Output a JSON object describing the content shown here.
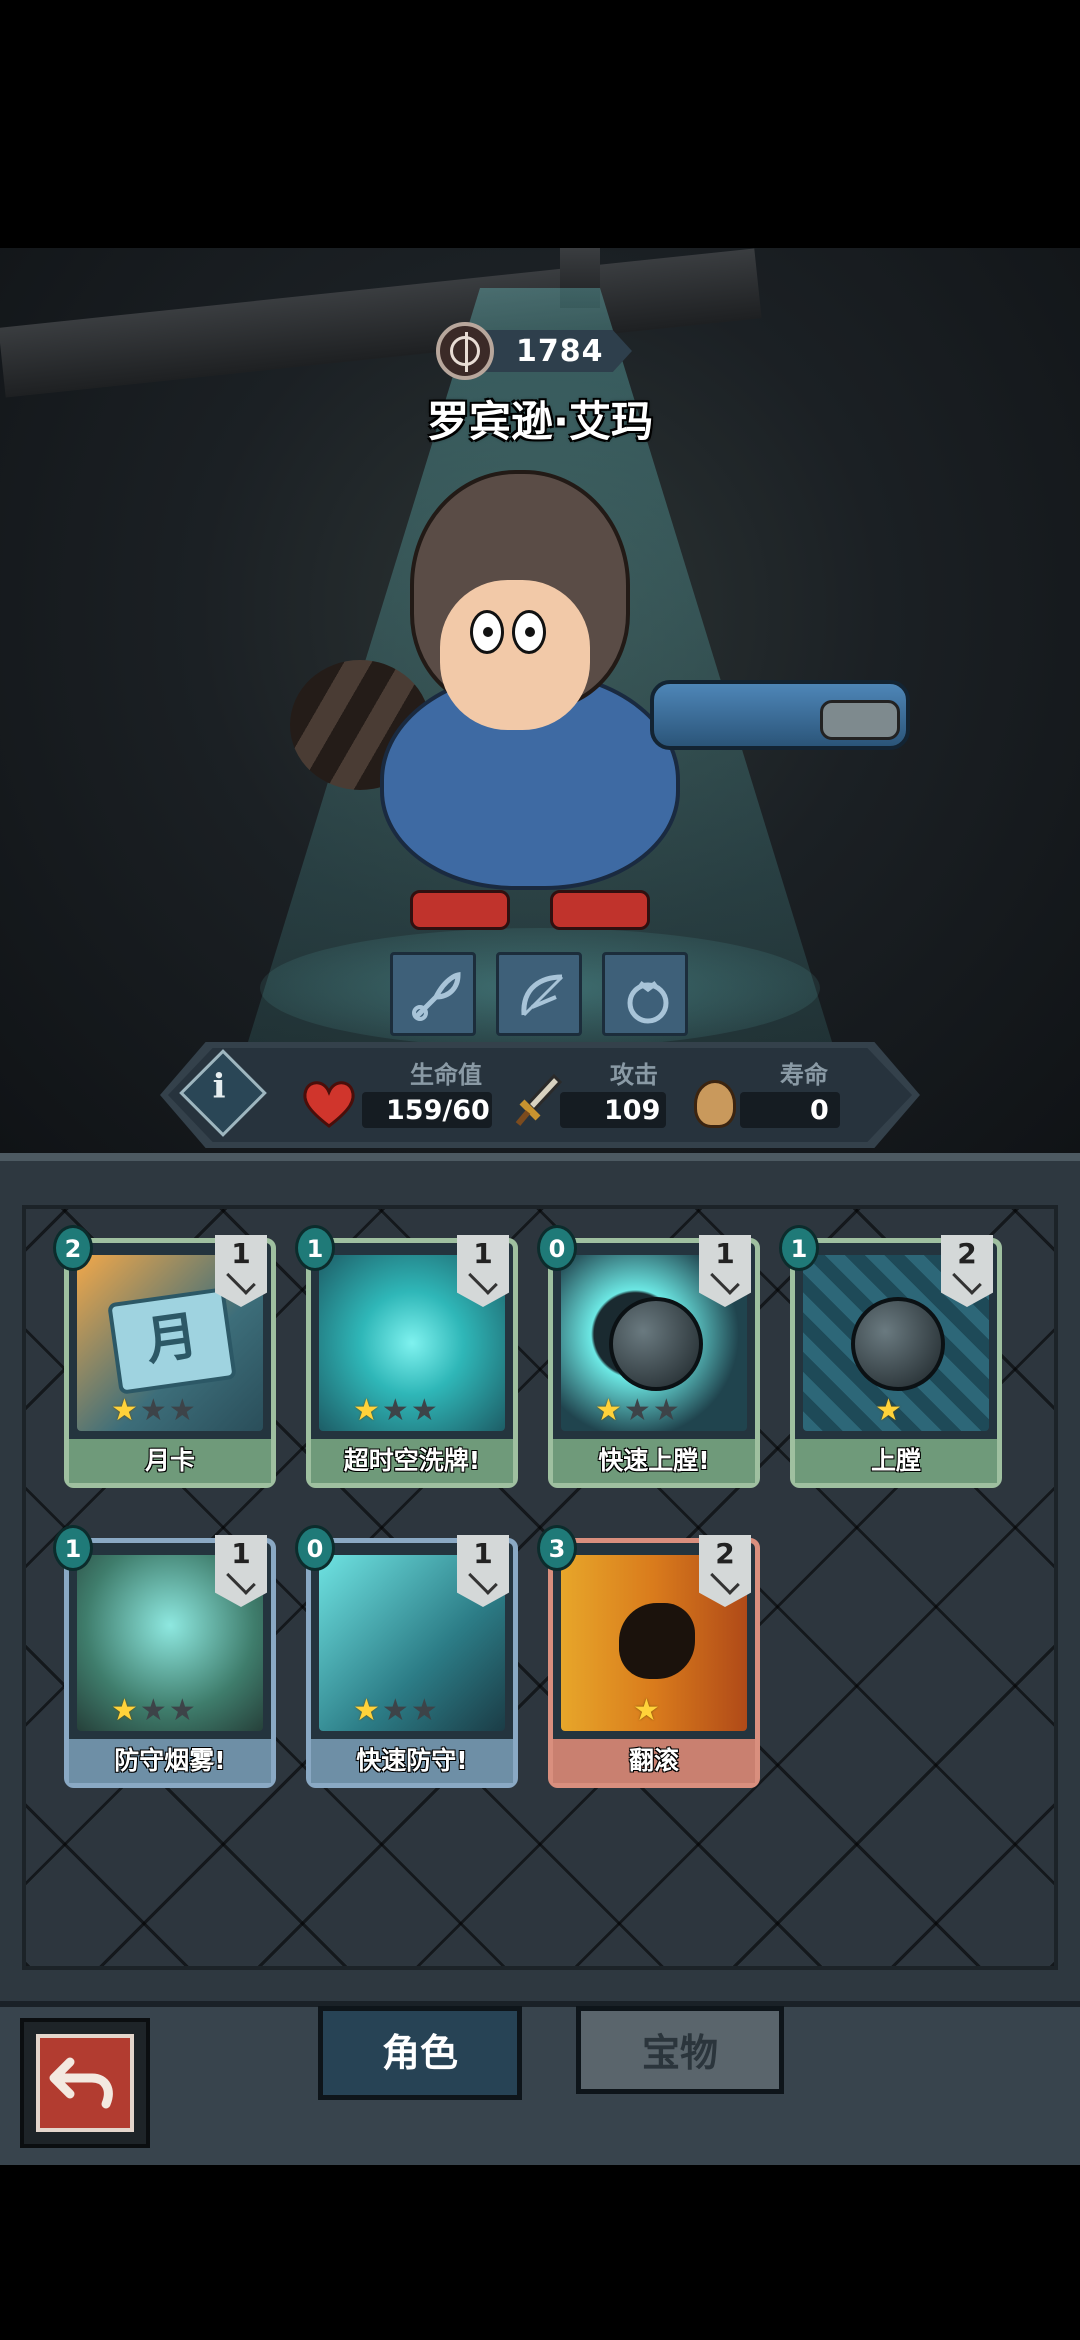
{
  "character": {
    "power": "1784",
    "name": "罗宾逊·艾玛"
  },
  "stats": {
    "hp_label": "生命值",
    "hp_value": "159/60",
    "attack_label": "攻击",
    "attack_value": "109",
    "lives_label": "寿命",
    "lives_value": "0",
    "info_glyph": "i"
  },
  "equipment": [
    "feather-quill-icon",
    "bow-icon",
    "sack-icon"
  ],
  "cards": [
    {
      "name": "月卡",
      "cost": "2",
      "level": "1",
      "stars": 1,
      "max_stars": 3,
      "art_text": "月",
      "frame": "green"
    },
    {
      "name": "超时空洗牌!",
      "cost": "1",
      "level": "1",
      "stars": 1,
      "max_stars": 3,
      "frame": "green"
    },
    {
      "name": "快速上膛!",
      "cost": "0",
      "level": "1",
      "stars": 1,
      "max_stars": 3,
      "frame": "green"
    },
    {
      "name": "上膛",
      "cost": "1",
      "level": "2",
      "stars": 1,
      "max_stars": 1,
      "frame": "green"
    },
    {
      "name": "防守烟雾!",
      "cost": "1",
      "level": "1",
      "stars": 1,
      "max_stars": 3,
      "frame": "blue"
    },
    {
      "name": "快速防守!",
      "cost": "0",
      "level": "1",
      "stars": 1,
      "max_stars": 3,
      "frame": "blue"
    },
    {
      "name": "翻滚",
      "cost": "3",
      "level": "2",
      "stars": 1,
      "max_stars": 1,
      "frame": "orange"
    }
  ],
  "tabs": {
    "active": "角色",
    "inactive": "宝物"
  },
  "colors": {
    "star_on": "#ffd23a",
    "card_green": "#9fc0a0",
    "card_blue": "#8aa9c4",
    "card_orange": "#d98f7e",
    "back_button": "#b23c30"
  }
}
